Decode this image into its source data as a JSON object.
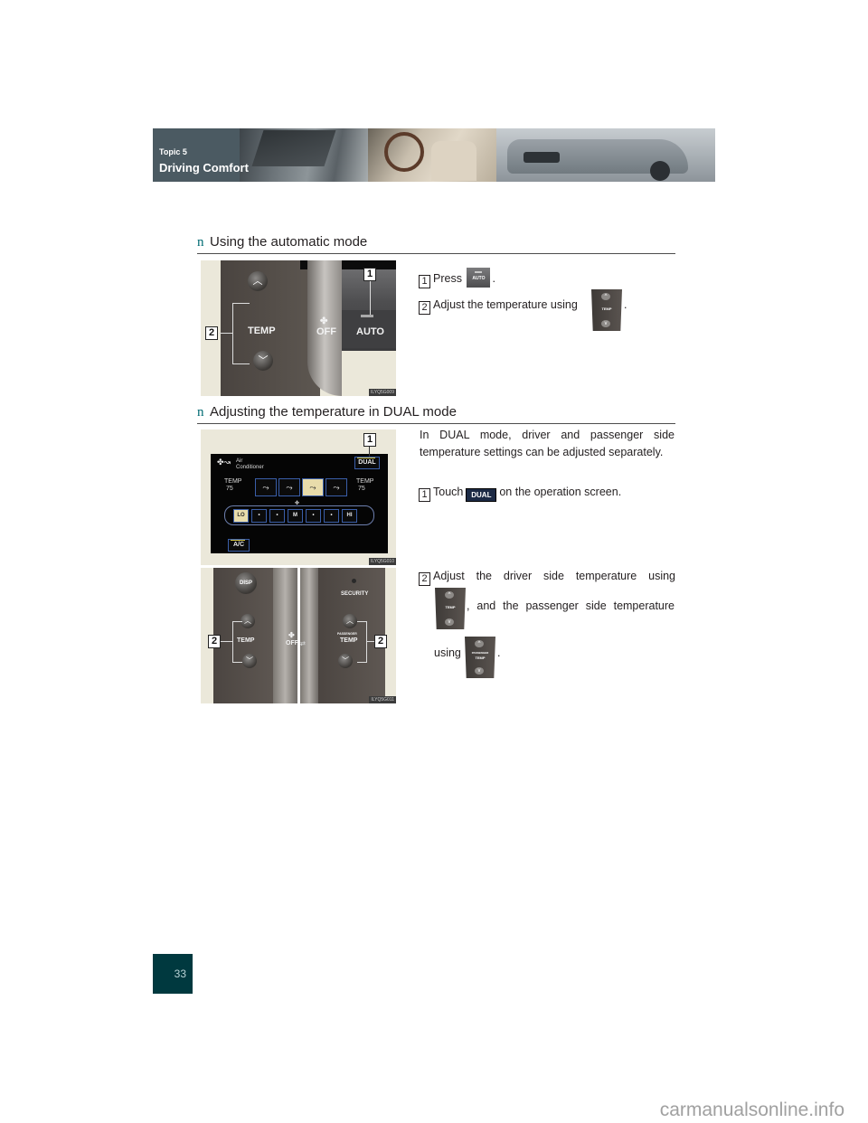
{
  "header": {
    "topic": "Topic 5",
    "title": "Driving Comfort"
  },
  "sections": [
    {
      "bullet": "n",
      "title": "Using the automatic mode",
      "figure": {
        "code": "ILYQ5G009",
        "labels": {
          "temp": "TEMP",
          "off": "OFF",
          "auto": "AUTO",
          "callout_1": "1",
          "callout_2": "2"
        }
      },
      "steps": [
        {
          "num": "1",
          "before": "Press",
          "icon": "auto-button-icon",
          "icon_label": "AUTO",
          "after": "."
        },
        {
          "num": "2",
          "before": "Adjust the temperature using",
          "icon": "temp-switch-icon",
          "icon_label": "TEMP",
          "after": "."
        }
      ]
    },
    {
      "bullet": "n",
      "title": "Adjusting the temperature in DUAL mode",
      "intro": "In DUAL mode, driver and passenger side temperature settings can be adjusted separately.",
      "figure_screen": {
        "code": "ILYQ5G010",
        "title_line1": "Air",
        "title_line2": "Conditioner",
        "dual": "DUAL",
        "temp_left_label": "TEMP",
        "temp_left_value": "75",
        "temp_right_label": "TEMP",
        "temp_right_value": "75",
        "fan_speeds": [
          "LO",
          "•",
          "•",
          "M",
          "•",
          "•",
          "HI"
        ],
        "ac": "A/C",
        "callout_1": "1"
      },
      "figure_panel": {
        "code": "ILYQ5G011",
        "disp": "DISP",
        "security": "SECURITY",
        "temp": "TEMP",
        "passenger": "PASSENGER",
        "passenger_temp": "TEMP",
        "off": "OFF",
        "callout_2": "2"
      },
      "steps": [
        {
          "num": "1",
          "before": "Touch",
          "icon": "dual-button-icon",
          "icon_label": "DUAL",
          "after": "on the operation screen."
        },
        {
          "num": "2",
          "line1": "Adjust the driver side temperature using",
          "line2": ", and the passenger side temperature",
          "line3_before": "using",
          "line3_after": ".",
          "icon_driver_label": "TEMP",
          "icon_passenger_label": "PASSENGER",
          "icon_passenger_temp": "TEMP"
        }
      ]
    }
  ],
  "page_number": "33",
  "watermark": "carmanualsonline.info",
  "colors": {
    "accent": "#006b73",
    "banner": "#4b5a62",
    "page_box": "#00393f"
  }
}
